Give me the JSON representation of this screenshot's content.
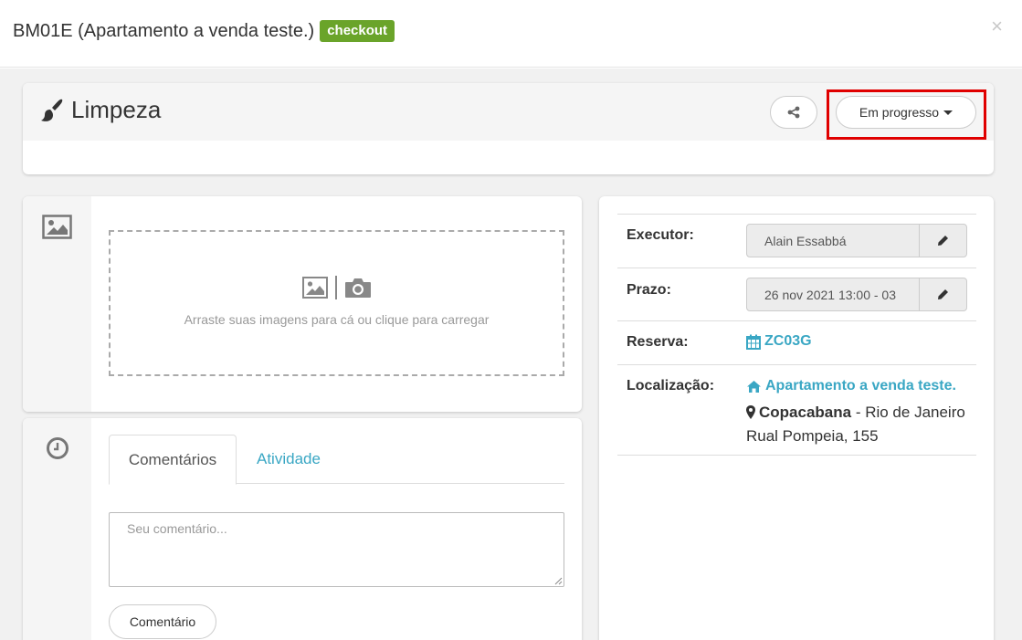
{
  "modal": {
    "title": "BM01E (Apartamento a venda teste.)",
    "badge": "checkout",
    "close": "×"
  },
  "task": {
    "title": "Limpeza",
    "status_label": "Em progresso"
  },
  "upload": {
    "hint": "Arraste suas imagens para cá ou clique para carregar"
  },
  "comments": {
    "tab_comments": "Comentários",
    "tab_activity": "Atividade",
    "placeholder": "Seu comentário...",
    "submit_label": "Comentário"
  },
  "details": {
    "executor_label": "Executor:",
    "executor_value": "Alain Essabbá",
    "deadline_label": "Prazo:",
    "deadline_value": "26 nov 2021 13:00 - 03",
    "booking_label": "Reserva:",
    "booking_value": "ZC03G",
    "location_label": "Localização:",
    "location_name": "Apartamento a venda teste.",
    "location_neighborhood": "Copacabana",
    "location_city": " - Rio de Janeiro",
    "location_address": "Rual Pompeia, 155"
  },
  "colors": {
    "badge": "#6aa42a",
    "link": "#3aa7c4",
    "highlight": "#e00000"
  }
}
